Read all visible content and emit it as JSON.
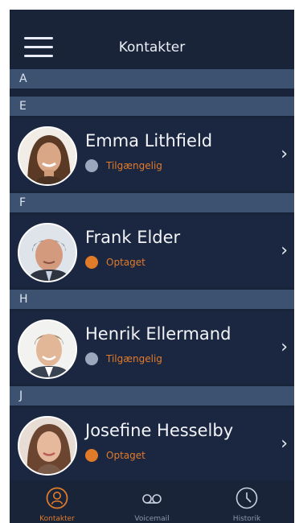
{
  "header": {
    "title": "Kontakter"
  },
  "colors": {
    "accent": "#e07b2a",
    "available": "#9aa7bd",
    "busy": "#e07b2a",
    "background": "#19233a",
    "section": "#3d5270"
  },
  "sections": [
    "A",
    "E",
    "F",
    "H",
    "J"
  ],
  "contacts": [
    {
      "name": "Emma Lithfield",
      "status": "Tilgængelig",
      "status_kind": "available"
    },
    {
      "name": "Frank Elder",
      "status": "Optaget",
      "status_kind": "busy"
    },
    {
      "name": "Henrik Ellermand",
      "status": "Tilgængelig",
      "status_kind": "available"
    },
    {
      "name": "Josefine Hesselby",
      "status": "Optaget",
      "status_kind": "busy"
    }
  ],
  "tabs": [
    {
      "label": "Kontakter",
      "icon": "person-icon",
      "active": true
    },
    {
      "label": "Voicemail",
      "icon": "voicemail-icon",
      "active": false
    },
    {
      "label": "Historik",
      "icon": "clock-icon",
      "active": false
    }
  ]
}
